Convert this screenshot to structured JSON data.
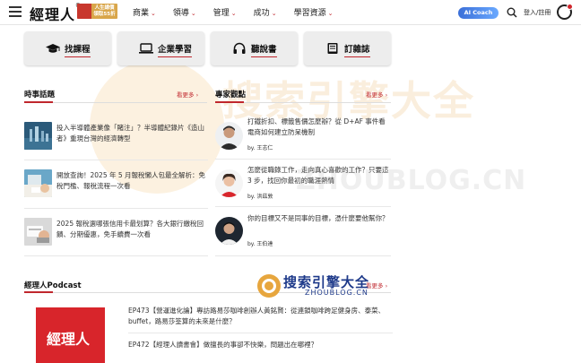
{
  "header": {
    "logo_text": "經理人",
    "logo_reg": "®",
    "promo_text": "人生總價 領取55折",
    "nav": [
      {
        "label": "商業"
      },
      {
        "label": "領導"
      },
      {
        "label": "管理"
      },
      {
        "label": "成功"
      },
      {
        "label": "學習資源"
      }
    ],
    "caret": "⌄",
    "ai_coach": "AI Coach",
    "login": "登入/註冊"
  },
  "watermark": {
    "big": "搜索引擎大全",
    "url": "ZHOUBLOG.CN",
    "badge_title": "搜索引擎大全",
    "badge_url": "ZHOUBLOG.CN"
  },
  "quick_links": [
    {
      "label": "找課程",
      "icon": "graduation-cap-icon"
    },
    {
      "label": "企業學習",
      "icon": "laptop-icon"
    },
    {
      "label": "聽說書",
      "icon": "headphones-icon"
    },
    {
      "label": "訂雜誌",
      "icon": "book-icon"
    }
  ],
  "news_section": {
    "title": "時事話題",
    "more": "看更多 ›",
    "items": [
      {
        "text": "投入半導體產業像「賭注」？半導體紀錄片《造山者》重現台灣的經濟轉型"
      },
      {
        "text": "開放查詢！2025 年 5 月報稅懶人包最全解析：免稅門檻、報稅流程一次看"
      },
      {
        "text": "2025 報稅選哪張信用卡最划算？各大銀行繳稅回饋、分期優惠，免手續費一次看"
      }
    ]
  },
  "column_section": {
    "title": "專家觀點",
    "more": "看更多 ›",
    "items": [
      {
        "title": "打鐵折扣、標籤售價怎麼辦？從 D+AF 事件看電商如何建立防呆機制",
        "author": "by. 王志仁"
      },
      {
        "title": "怎麼從職錄工作，走向真心喜歡的工作？只要這 3 步，找回你最初的職涯熱情",
        "author": "by. 洪茲敦"
      },
      {
        "title": "你的目標又不是同事的目標，憑什麼要他幫你？",
        "author": "by. 王伯達"
      }
    ]
  },
  "podcast_section": {
    "title": "經理人Podcast",
    "more": "看更多 ›",
    "cover_text": "經理人",
    "items": [
      {
        "text": "EP473【營運進化論】專訪路易莎咖啡創辦人黃銘賢：從連鎖咖啡跨足健身房、泰菜、buffet，路易莎筌算的未來是什麼？"
      },
      {
        "text": "EP472【經理人讀書會】做擅長的事卻不快樂，問題出在哪裡？"
      }
    ]
  },
  "colors": {
    "accent": "#c0272d",
    "button_bg": "#ededed",
    "ai_coach_blue": "#3b6fd8"
  }
}
